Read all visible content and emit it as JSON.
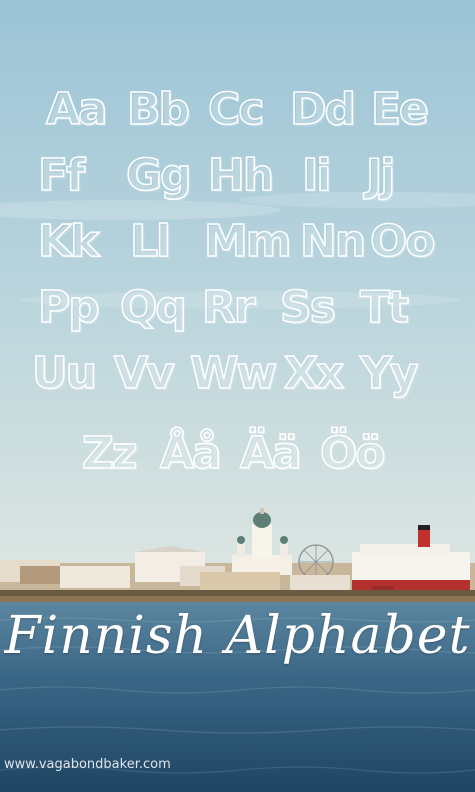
{
  "letters": {
    "row1": [
      "Aa",
      "Bb",
      "Cc",
      "Dd",
      "Ee"
    ],
    "row2": [
      "Ff",
      "Gg",
      "Hh",
      "Ii",
      "Jj"
    ],
    "row3": [
      "Kk",
      "Ll",
      "Mm",
      "Nn",
      "Oo"
    ],
    "row4": [
      "Pp",
      "Qq",
      "Rr",
      "Ss",
      "Tt"
    ],
    "row5": [
      "Uu",
      "Vv",
      "Ww",
      "Xx",
      "Yy"
    ],
    "row6": [
      "Zz",
      "Åå",
      "Ää",
      "Öö"
    ]
  },
  "title": "Finnish Alphabet",
  "watermark": "www.vagabondbaker.com",
  "colors": {
    "sky_top": "#9fc6d6",
    "sky_bottom": "#d9e6e6",
    "sea": "#3f6f8f",
    "sea_dark": "#23496a",
    "letter_outline": "#ffffff"
  }
}
